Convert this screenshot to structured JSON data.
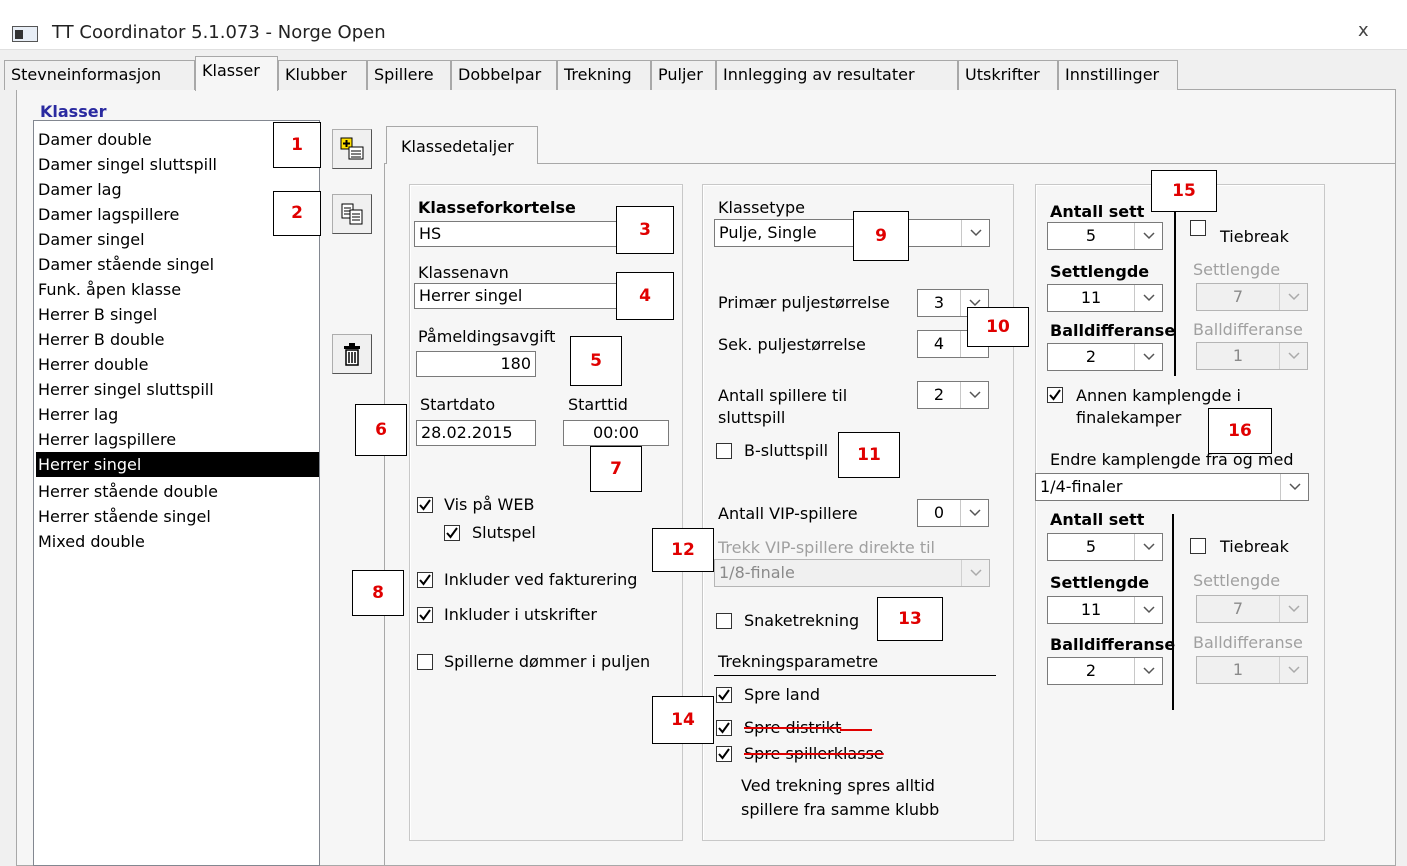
{
  "window": {
    "title": "TT Coordinator 5.1.073 - Norge Open",
    "close_label": "x"
  },
  "tabs": [
    "Stevneinformasjon",
    "Klasser",
    "Klubber",
    "Spillere",
    "Dobbelpar",
    "Trekning",
    "Puljer",
    "Innlegging av resultater",
    "Utskrifter",
    "Innstillinger"
  ],
  "sidebar": {
    "heading": "Klasser",
    "items": [
      "Damer double",
      "Damer singel sluttspill",
      "Damer lag",
      "Damer lagspillere",
      "Damer singel",
      "Damer stående singel",
      "Funk. åpen klasse",
      "Herrer B singel",
      "Herrer B double",
      "Herrer double",
      "Herrer singel sluttspill",
      "Herrer lag",
      "Herrer lagspillere",
      "Herrer singel",
      "Herrer stående double",
      "Herrer stående singel",
      "Mixed double"
    ],
    "selected_item": "Herrer singel"
  },
  "toolbar_icons": {
    "add": "add-class-icon",
    "copy": "copy-class-icon",
    "delete": "trash-icon"
  },
  "badges": [
    "1",
    "2",
    "3",
    "4",
    "5",
    "6",
    "7",
    "8",
    "9",
    "10",
    "11",
    "12",
    "13",
    "14",
    "15",
    "16"
  ],
  "subtab": "Klassedetaljer",
  "details": {
    "abbr_label": "Klasseforkortelse",
    "abbr_value": "HS",
    "name_label": "Klassenavn",
    "name_value": "Herrer singel",
    "fee_label": "Påmeldingsavgift",
    "fee_value": "180",
    "startdate_label": "Startdato",
    "startdate_value": "28.02.2015",
    "starttime_label": "Starttid",
    "starttime_value": "00:00",
    "vis_web": "Vis på WEB",
    "slutspel": "Slutspel",
    "inkluder_fakt": "Inkluder ved fakturering",
    "inkluder_utskr": "Inkluder i utskrifter",
    "dommer": "Spillerne dømmer i puljen"
  },
  "middle": {
    "klassetype_label": "Klassetype",
    "klassetype_value": "Pulje, Single",
    "primary_label": "Primær puljestørrelse",
    "primary_value": "3",
    "secondary_label": "Sek. puljestørrelse",
    "secondary_value": "4",
    "antall_label_1": "Antall spillere til",
    "antall_label_2": "sluttspill",
    "antall_value": "2",
    "b_sluttspill": "B-sluttspill",
    "vip_label": "Antall VIP-spillere",
    "vip_value": "0",
    "trekk_vip_label": "Trekk VIP-spillere direkte til",
    "trekk_vip_value": "1/8-finale",
    "snake": "Snaketrekning",
    "trekning_header": "Trekningsparametre",
    "spre_land": "Spre land",
    "spre_distrikt": "Spre distrikt",
    "spre_klasse": "Spre spillerklasse",
    "note_1": "Ved trekning spres alltid",
    "note_2": "spillere fra samme klubb"
  },
  "right": {
    "antall_sett_label": "Antall sett",
    "antall_sett_value": "5",
    "tiebreak": "Tiebreak",
    "settlengde_label": "Settlengde",
    "settlengde_value": "11",
    "settlengde_dis_value": "7",
    "balldiff_label": "Balldifferanse",
    "balldiff_value": "2",
    "balldiff_dis_value": "1",
    "annen_1": "Annen kamplengde i",
    "annen_2": "finalekamper",
    "endre_label": "Endre kamplengde fra og med",
    "endre_value": "1/4-finaler",
    "antall_sett_value_2": "5",
    "settlengde_value_2": "11",
    "settlengde_dis_value_2": "7",
    "balldiff_value_2": "2",
    "balldiff_dis_value_2": "1"
  }
}
